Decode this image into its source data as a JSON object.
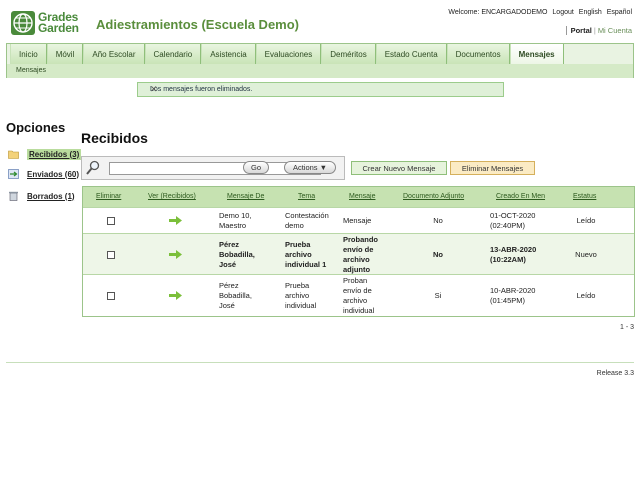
{
  "header": {
    "logo_line1": "Grades",
    "logo_line2": "Garden",
    "app_title": "Adiestramientos (Escuela Demo)",
    "welcome": "Welcome: ENCARGADODEMO",
    "logout": "Logout",
    "english": "English",
    "espanol": "Español",
    "portal": "Portal",
    "mi_cuenta": "Mi Cuenta"
  },
  "nav": {
    "tabs": [
      "Inicio",
      "Móvil",
      "Año Escolar",
      "Calendario",
      "Asistencia",
      "Evaluaciones",
      "Deméritos",
      "Estado Cuenta",
      "Documentos",
      "Mensajes"
    ],
    "active_tab": "Mensajes",
    "sub_item": "Mensajes"
  },
  "notice": {
    "text": "Los mensajes fueron eliminados.",
    "close": "✕"
  },
  "sidebar": {
    "title": "Opciones",
    "items": [
      {
        "label": "Recibidos (3)",
        "icon": "folder-icon"
      },
      {
        "label": "Enviados (60)",
        "icon": "send-icon"
      },
      {
        "label": "Borrados (1)",
        "icon": "trash-icon"
      }
    ]
  },
  "main": {
    "title": "Recibidos",
    "search_value": "",
    "go_label": "Go",
    "actions_label": "Actions ▼",
    "crear_label": "Crear Nuevo Mensaje",
    "eliminar_label": "Eliminar Mensajes"
  },
  "table": {
    "headers": [
      "Eliminar",
      "Ver (Recibidos)",
      "Mensaje De",
      "Tema",
      "Mensaje",
      "Documento Adjunto",
      "Creado En Men",
      "Estatus"
    ],
    "rows": [
      {
        "de": [
          "Demo 10,",
          "Maestro"
        ],
        "tema": [
          "Contestación",
          "demo"
        ],
        "mensaje": [
          "Mensaje"
        ],
        "adjunto": "No",
        "creado": [
          "01-OCT-2020",
          "(02:40PM)"
        ],
        "estatus": "Leído",
        "bold": false
      },
      {
        "de": [
          "Pérez",
          "Bobadilla,",
          "José"
        ],
        "tema": [
          "Prueba",
          "archivo",
          "individual 1"
        ],
        "mensaje": [
          "Probando",
          "envío de",
          "archivo",
          "adjunto"
        ],
        "adjunto": "No",
        "creado": [
          "13-ABR-2020",
          "(10:22AM)"
        ],
        "estatus": "Nuevo",
        "bold": true
      },
      {
        "de": [
          "Pérez",
          "Bobadilla,",
          "José"
        ],
        "tema": [
          "Prueba",
          "archivo",
          "individual"
        ],
        "mensaje": [
          "Proban",
          "envío de",
          "archivo",
          "individual"
        ],
        "adjunto": "Si",
        "creado": [
          "10-ABR-2020",
          "(01:45PM)"
        ],
        "estatus": "Leído",
        "bold": false
      }
    ]
  },
  "pager": "1 - 3",
  "footer": {
    "release": "Release 3.3"
  },
  "colors": {
    "brand_green": "#5a8e3c",
    "nav_border": "#9cc48a",
    "header_row": "#c6e2b1"
  }
}
